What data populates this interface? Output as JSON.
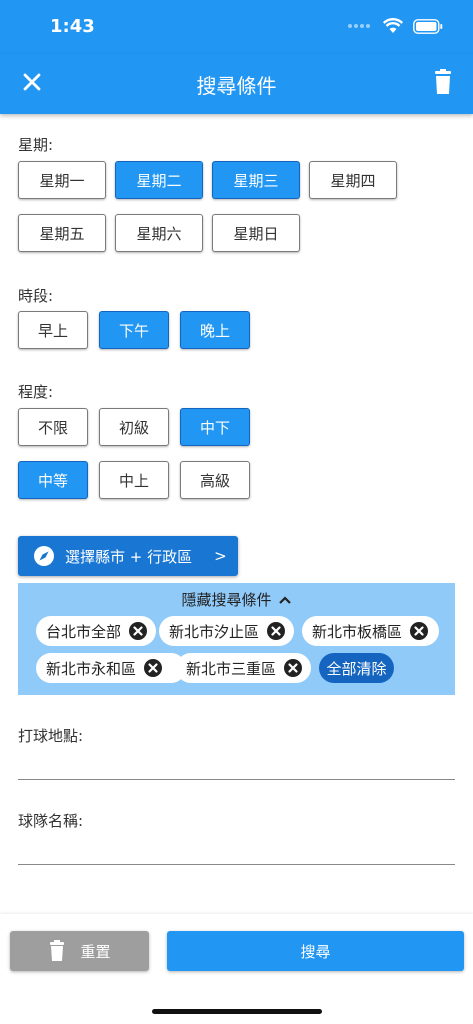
{
  "status": {
    "time": "1:43"
  },
  "appbar": {
    "title": "搜尋條件"
  },
  "weekday": {
    "label": "星期:",
    "options": [
      {
        "label": "星期一",
        "selected": false
      },
      {
        "label": "星期二",
        "selected": true
      },
      {
        "label": "星期三",
        "selected": true
      },
      {
        "label": "星期四",
        "selected": false
      },
      {
        "label": "星期五",
        "selected": false
      },
      {
        "label": "星期六",
        "selected": false
      },
      {
        "label": "星期日",
        "selected": false
      }
    ]
  },
  "timeslot": {
    "label": "時段:",
    "options": [
      {
        "label": "早上",
        "selected": false
      },
      {
        "label": "下午",
        "selected": true
      },
      {
        "label": "晚上",
        "selected": true
      }
    ]
  },
  "level": {
    "label": "程度:",
    "options": [
      {
        "label": "不限",
        "selected": false
      },
      {
        "label": "初級",
        "selected": false
      },
      {
        "label": "中下",
        "selected": true
      },
      {
        "label": "中等",
        "selected": true
      },
      {
        "label": "中上",
        "selected": false
      },
      {
        "label": "高級",
        "selected": false
      }
    ]
  },
  "region": {
    "button_label": "選擇縣市 + 行政區",
    "arrow": ">"
  },
  "hidden_panel": {
    "title": "隱藏搜尋條件",
    "tags": [
      "台北市全部",
      "新北市汐止區",
      "新北市板橋區",
      "新北市永和區",
      "新北市三重區"
    ],
    "clear_all": "全部清除"
  },
  "fields": {
    "venue_label": "打球地點:",
    "venue_value": "",
    "team_label": "球隊名稱:",
    "team_value": ""
  },
  "bottom": {
    "reset_label": "重置",
    "search_label": "搜尋"
  },
  "colors": {
    "primary": "#2196f3",
    "primary_dark": "#1565c0",
    "panel": "#90caf9",
    "reset": "#9e9e9e"
  }
}
